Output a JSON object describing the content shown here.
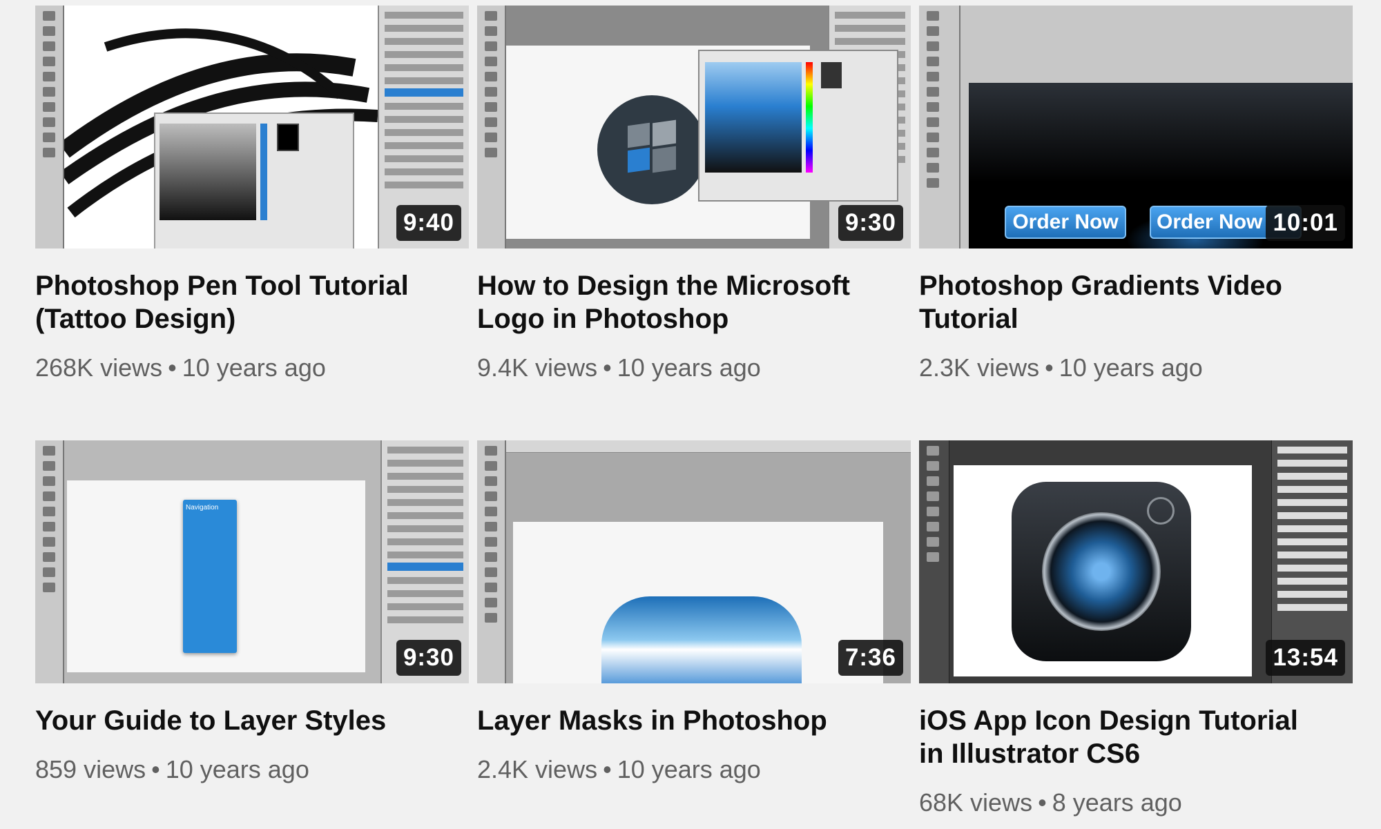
{
  "videos": [
    {
      "title": "Photoshop Pen Tool Tutorial (Tattoo Design)",
      "duration": "9:40",
      "views": "268K views",
      "age": "10 years ago"
    },
    {
      "title": "How to Design the Microsoft Logo in Photoshop",
      "duration": "9:30",
      "views": "9.4K views",
      "age": "10 years ago"
    },
    {
      "title": "Photoshop Gradients Video Tutorial",
      "duration": "10:01",
      "views": "2.3K views",
      "age": "10 years ago",
      "thumb_buttons": [
        "Order Now",
        "Order Now"
      ]
    },
    {
      "title": "Your Guide to Layer Styles",
      "duration": "9:30",
      "views": "859 views",
      "age": "10 years ago",
      "thumb_panel_title": "Navigation"
    },
    {
      "title": "Layer Masks in Photoshop",
      "duration": "7:36",
      "views": "2.4K views",
      "age": "10 years ago"
    },
    {
      "title": "iOS App Icon Design Tutorial in Illustrator CS6",
      "duration": "13:54",
      "views": "68K views",
      "age": "8 years ago"
    }
  ],
  "separator": "•",
  "colors": {
    "background": "#f1f1f1",
    "title": "#0f0f0f",
    "meta": "#606060",
    "duration_bg": "#0f0f0f",
    "accent_blue": "#2a7fd0"
  }
}
